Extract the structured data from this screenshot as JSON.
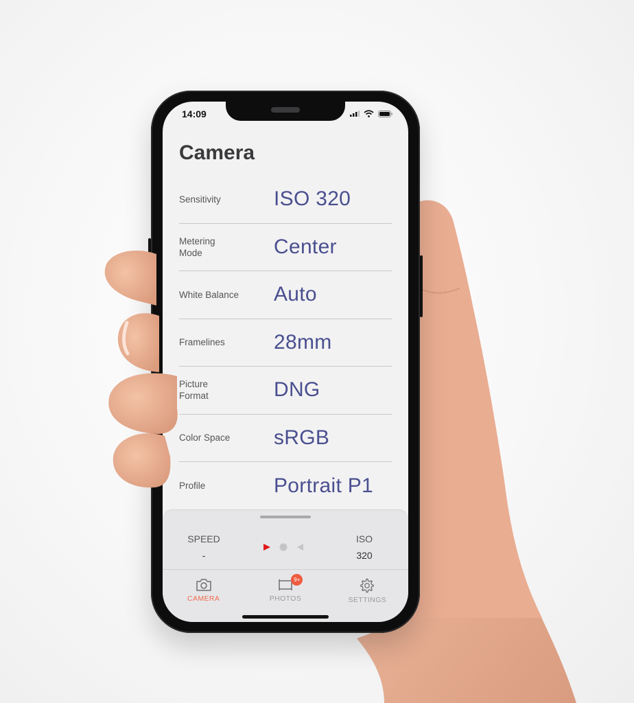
{
  "status_bar": {
    "time": "14:09",
    "icons": [
      "cellular-signal-icon",
      "wifi-icon",
      "battery-icon"
    ]
  },
  "screen": {
    "title": "Camera",
    "settings": [
      {
        "label": "Sensitivity",
        "value": "ISO 320"
      },
      {
        "label": "Metering\nMode",
        "value": "Center"
      },
      {
        "label": "White Balance",
        "value": "Auto"
      },
      {
        "label": "Framelines",
        "value": "28mm"
      },
      {
        "label": "Picture\nFormat",
        "value": "DNG"
      },
      {
        "label": "Color Space",
        "value": "sRGB"
      },
      {
        "label": "Profile",
        "value": "Portrait P1"
      }
    ]
  },
  "panel": {
    "speed_label": "SPEED",
    "speed_value": "-",
    "iso_label": "ISO",
    "iso_value": "320",
    "indicators": [
      "play-right-icon",
      "dot-icon",
      "play-left-icon"
    ]
  },
  "tabbar": {
    "tabs": [
      {
        "label": "CAMERA",
        "icon": "camera-icon",
        "active": true
      },
      {
        "label": "PHOTOS",
        "icon": "film-icon",
        "badge": "9+"
      },
      {
        "label": "SETTINGS",
        "icon": "gear-icon"
      }
    ]
  },
  "colors": {
    "accent": "#ef6b4f",
    "value_text": "#4a4f8f",
    "indicator_active": "#e01b1b",
    "badge": "#ef5b3f"
  }
}
